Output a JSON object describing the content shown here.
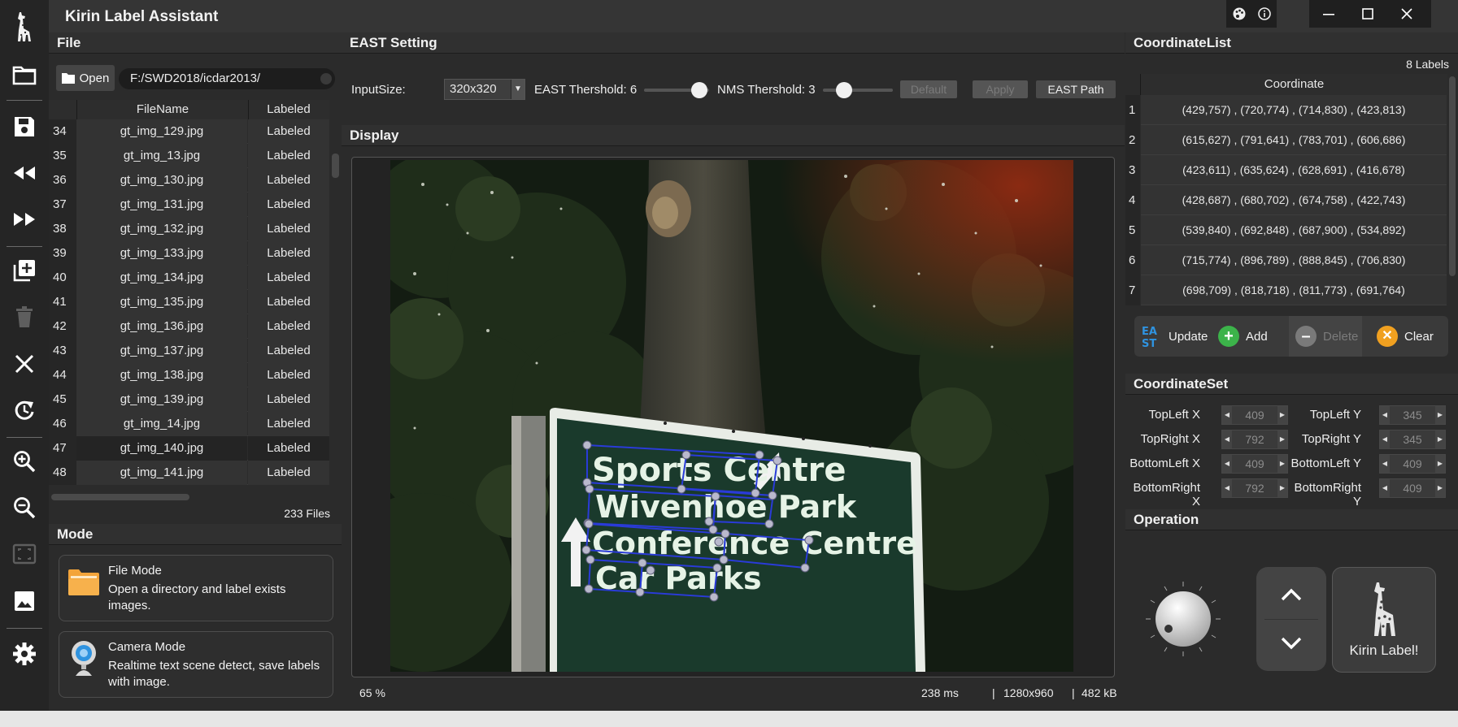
{
  "window": {
    "title": "Kirin Label Assistant",
    "controls": [
      "minimize",
      "maximize",
      "close"
    ]
  },
  "sidebar_icons": [
    "giraffe-logo-icon",
    "folder-icon",
    "save-icon",
    "rewind-icon",
    "fast-forward-icon",
    "add-image-icon",
    "trash-icon",
    "close-icon",
    "refresh-icon",
    "zoom-in-icon",
    "zoom-out-icon",
    "fit-screen-icon",
    "image-icon",
    "settings-icon"
  ],
  "file_panel": {
    "header": "File",
    "open_label": "Open",
    "path": "F:/SWD2018/icdar2013/",
    "columns": [
      "FileName",
      "Labeled"
    ],
    "rows": [
      {
        "num": "34",
        "name": "gt_img_129.jpg",
        "status": "Labeled"
      },
      {
        "num": "35",
        "name": "gt_img_13.jpg",
        "status": "Labeled"
      },
      {
        "num": "36",
        "name": "gt_img_130.jpg",
        "status": "Labeled"
      },
      {
        "num": "37",
        "name": "gt_img_131.jpg",
        "status": "Labeled"
      },
      {
        "num": "38",
        "name": "gt_img_132.jpg",
        "status": "Labeled"
      },
      {
        "num": "39",
        "name": "gt_img_133.jpg",
        "status": "Labeled"
      },
      {
        "num": "40",
        "name": "gt_img_134.jpg",
        "status": "Labeled"
      },
      {
        "num": "41",
        "name": "gt_img_135.jpg",
        "status": "Labeled"
      },
      {
        "num": "42",
        "name": "gt_img_136.jpg",
        "status": "Labeled"
      },
      {
        "num": "43",
        "name": "gt_img_137.jpg",
        "status": "Labeled"
      },
      {
        "num": "44",
        "name": "gt_img_138.jpg",
        "status": "Labeled"
      },
      {
        "num": "45",
        "name": "gt_img_139.jpg",
        "status": "Labeled"
      },
      {
        "num": "46",
        "name": "gt_img_14.jpg",
        "status": "Labeled"
      },
      {
        "num": "47",
        "name": "gt_img_140.jpg",
        "status": "Labeled"
      },
      {
        "num": "48",
        "name": "gt_img_141.jpg",
        "status": "Labeled"
      }
    ],
    "selected_row": "47",
    "file_count": "233 Files"
  },
  "mode_panel": {
    "header": "Mode",
    "file_mode": {
      "title": "File Mode",
      "desc": "Open a directory and label exists images."
    },
    "camera_mode": {
      "title": "Camera Mode",
      "desc": "Realtime text scene detect, save labels with image."
    }
  },
  "east_setting": {
    "header": "EAST Setting",
    "input_size_label": "InputSize:",
    "input_size_value": "320x320",
    "east_threshold_label": "EAST Thershold: 6",
    "east_threshold_level": 0.6,
    "nms_threshold_label": "NMS Thershold: 3",
    "nms_threshold_level": 0.3,
    "default_label": "Default",
    "apply_label": "Apply",
    "east_path_label": "EAST Path"
  },
  "display": {
    "header": "Display",
    "zoom": "65 %",
    "time": "238 ms",
    "resolution": "1280x960",
    "size": "482 kB",
    "sign_lines": [
      "Sports Centre",
      "Wivenhoe Park",
      "Conference Centre",
      "Car Parks"
    ]
  },
  "coordinate_list": {
    "header": "CoordinateList",
    "count": "8 Labels",
    "column": "Coordinate",
    "rows": [
      {
        "num": "1",
        "value": "(429,757) , (720,774) , (714,830) , (423,813)"
      },
      {
        "num": "2",
        "value": "(615,627) , (791,641) , (783,701) , (606,686)"
      },
      {
        "num": "3",
        "value": "(423,611) , (635,624) , (628,691) , (416,678)"
      },
      {
        "num": "4",
        "value": "(428,687) , (680,702) , (674,758) , (422,743)"
      },
      {
        "num": "5",
        "value": "(539,840) , (692,848) , (687,900) , (534,892)"
      },
      {
        "num": "6",
        "value": "(715,774) , (896,789) , (888,845) , (706,830)"
      },
      {
        "num": "7",
        "value": "(698,709) , (818,718) , (811,773) , (691,764)"
      }
    ],
    "actions": {
      "update": "Update",
      "add": "Add",
      "delete": "Delete",
      "clear": "Clear",
      "east_badge_top": "EA",
      "east_badge_bottom": "ST"
    }
  },
  "coordinate_set": {
    "header": "CoordinateSet",
    "fields": [
      {
        "label": "TopLeft X",
        "value": "409"
      },
      {
        "label": "TopLeft Y",
        "value": "345"
      },
      {
        "label": "TopRight X",
        "value": "792"
      },
      {
        "label": "TopRight Y",
        "value": "345"
      },
      {
        "label": "BottomLeft X",
        "value": "409"
      },
      {
        "label": "BottomLeft Y",
        "value": "409"
      },
      {
        "label": "BottomRight X",
        "value": "792"
      },
      {
        "label": "BottomRight Y",
        "value": "409"
      }
    ]
  },
  "operation": {
    "header": "Operation",
    "kirin_label": "Kirin Label!"
  },
  "colors": {
    "accent_blue": "#2f93e0",
    "add_green": "#3cb34a",
    "clear_orange": "#f0a020",
    "folder_orange": "#f3a43a",
    "box_blue": "#2a3bd8"
  }
}
